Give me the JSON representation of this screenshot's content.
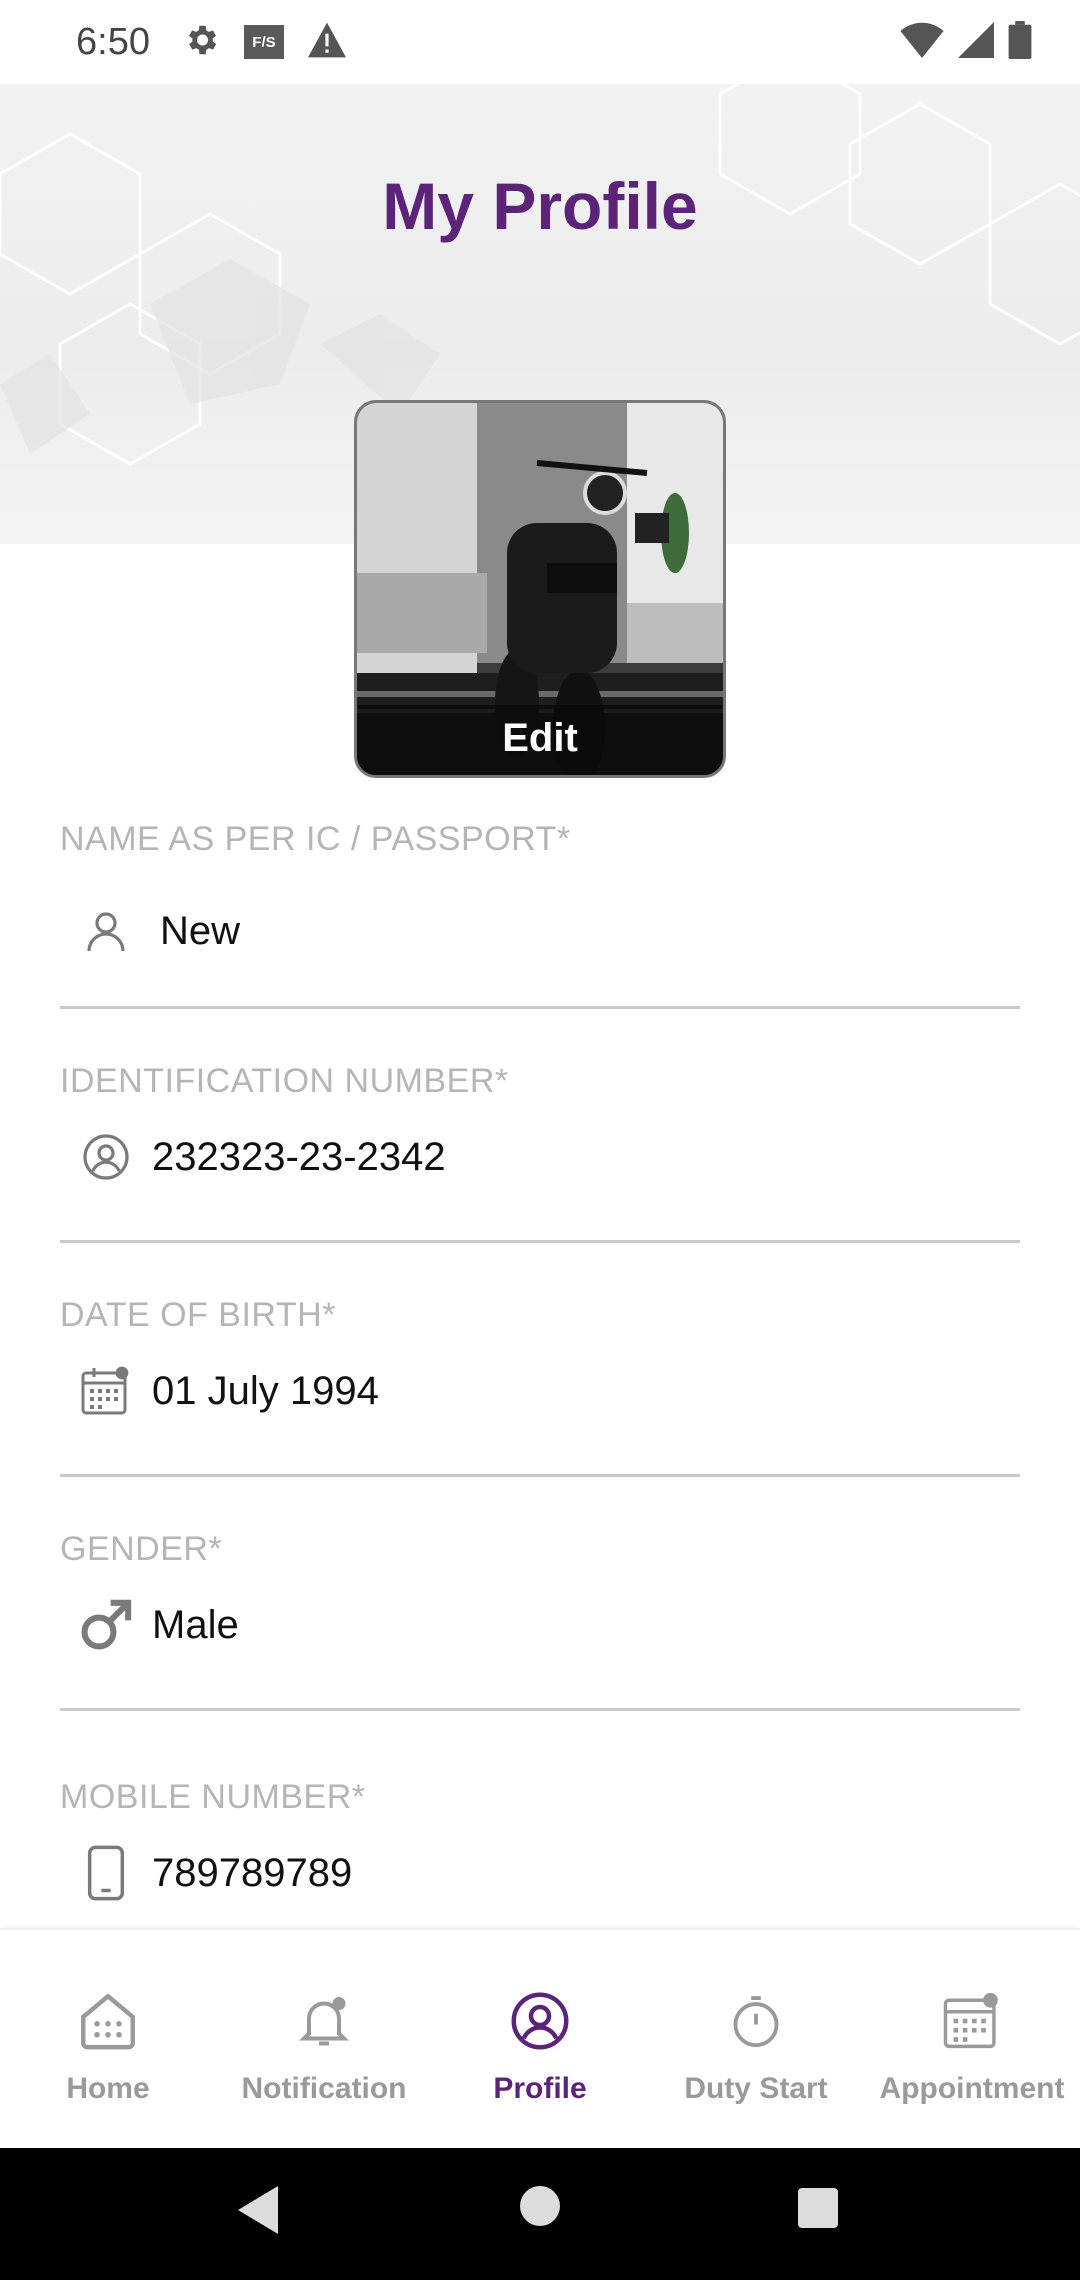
{
  "status_bar": {
    "time": "6:50",
    "fys_label": "F/S",
    "icons": [
      "gear-icon",
      "fys-icon",
      "warning-icon",
      "wifi-icon",
      "signal-icon",
      "battery-icon"
    ]
  },
  "header": {
    "title": "My Profile"
  },
  "avatar": {
    "edit_label": "Edit"
  },
  "form": {
    "fields": [
      {
        "label": "NAME AS PER IC / PASSPORT*",
        "value": "New",
        "icon": "person-icon"
      },
      {
        "label": "IDENTIFICATION NUMBER*",
        "value": "232323-23-2342",
        "icon": "id-circle-icon"
      },
      {
        "label": "DATE OF BIRTH*",
        "value": "01 July 1994",
        "icon": "calendar-icon"
      },
      {
        "label": "GENDER*",
        "value": "Male",
        "icon": "male-icon"
      },
      {
        "label": "MOBILE NUMBER*",
        "value": "789789789",
        "icon": "mobile-phone-icon"
      }
    ]
  },
  "bottom_nav": {
    "active": "Profile",
    "accent_color": "#5b2479",
    "items": [
      {
        "label": "Home",
        "icon": "home-icon"
      },
      {
        "label": "Notification",
        "icon": "bell-icon"
      },
      {
        "label": "Profile",
        "icon": "profile-icon"
      },
      {
        "label": "Duty Start",
        "icon": "stopwatch-icon"
      },
      {
        "label": "Appointment",
        "icon": "calendar-icon"
      }
    ]
  }
}
